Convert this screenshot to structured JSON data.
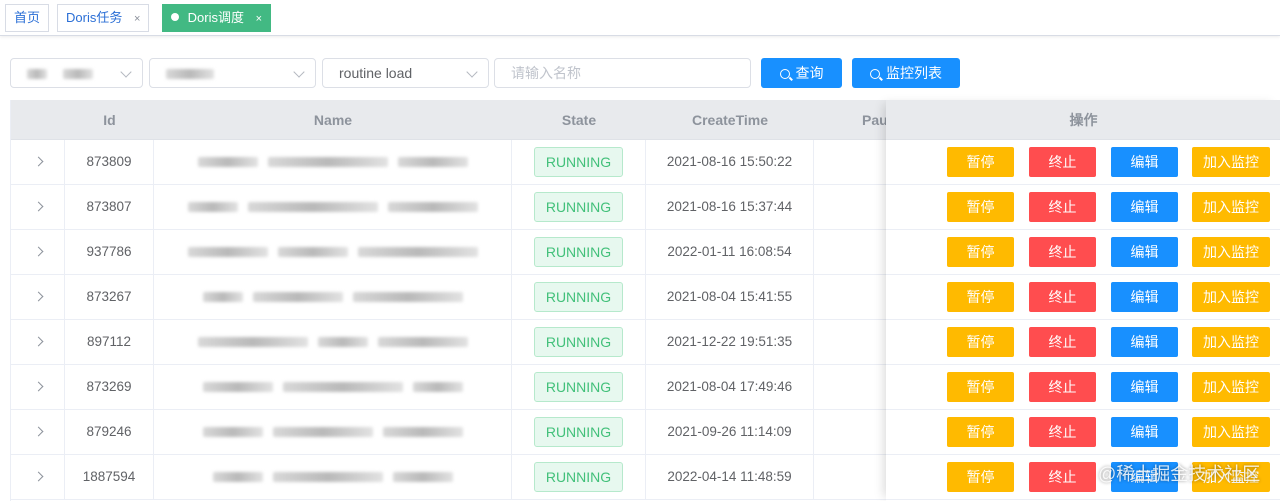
{
  "tabs": [
    {
      "label": "首页",
      "close": ""
    },
    {
      "label": "Doris任务",
      "close": "×"
    },
    {
      "label": "Doris调度",
      "close": "×"
    }
  ],
  "filters": {
    "type_select": "routine load",
    "name_placeholder": "请输入名称",
    "query_label": "查询",
    "monitor_list_label": "监控列表"
  },
  "table": {
    "headers": {
      "id": "Id",
      "name": "Name",
      "state": "State",
      "create_time": "CreateTime",
      "pause": "Pau",
      "ops": "操作"
    },
    "rows": [
      {
        "id": "873809",
        "state": "RUNNING",
        "create_time": "2021-08-16 15:50:22"
      },
      {
        "id": "873807",
        "state": "RUNNING",
        "create_time": "2021-08-16 15:37:44"
      },
      {
        "id": "937786",
        "state": "RUNNING",
        "create_time": "2022-01-11 16:08:54"
      },
      {
        "id": "873267",
        "state": "RUNNING",
        "create_time": "2021-08-04 15:41:55"
      },
      {
        "id": "897112",
        "state": "RUNNING",
        "create_time": "2021-12-22 19:51:35"
      },
      {
        "id": "873269",
        "state": "RUNNING",
        "create_time": "2021-08-04 17:49:46"
      },
      {
        "id": "879246",
        "state": "RUNNING",
        "create_time": "2021-09-26 11:14:09"
      },
      {
        "id": "1887594",
        "state": "RUNNING",
        "create_time": "2022-04-14 11:48:59"
      }
    ],
    "actions": {
      "pause": "暂停",
      "stop": "终止",
      "edit": "编辑",
      "monitor": "加入监控"
    }
  },
  "watermark": "@稀土掘金技术社区",
  "colors": {
    "accent": "#1890ff",
    "tab_active": "#42b983",
    "warning": "#ffba00",
    "danger": "#ff4d4f",
    "success": "#42c07a"
  }
}
